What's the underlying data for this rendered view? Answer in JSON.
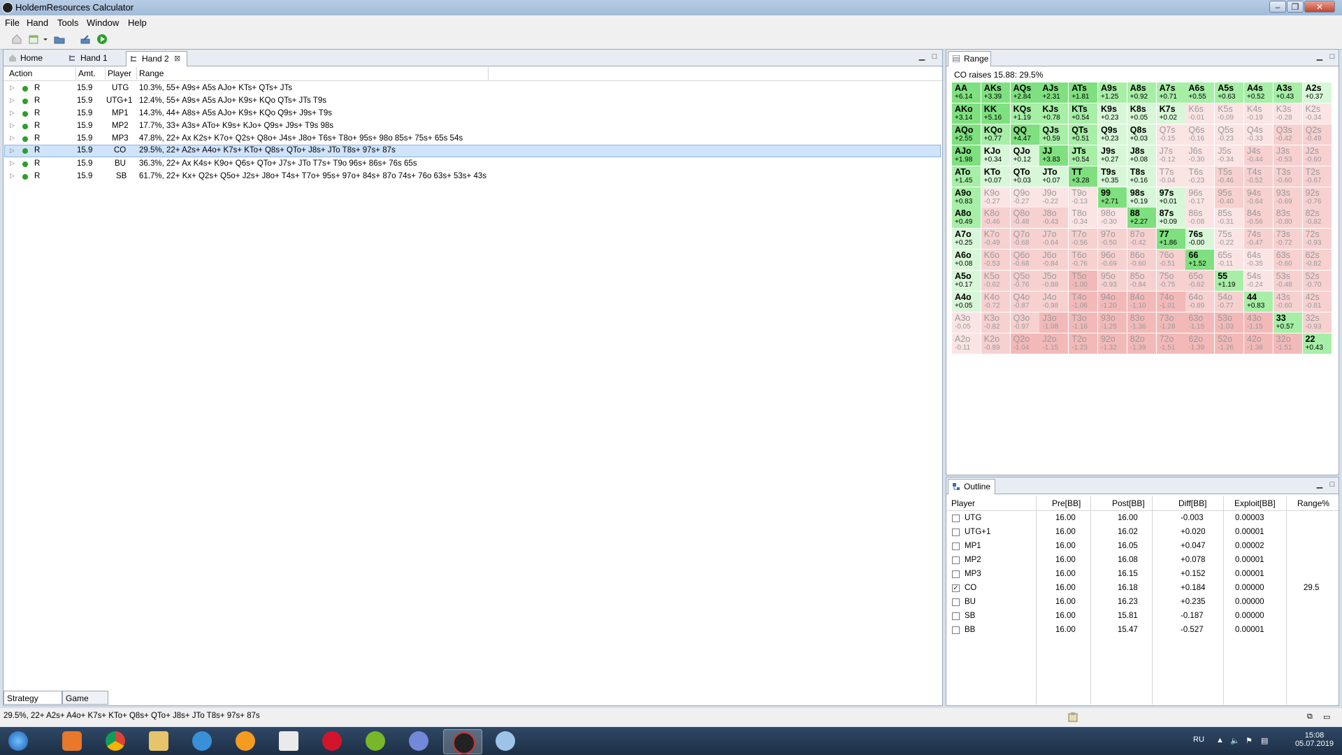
{
  "window": {
    "title": "HoldemResources Calculator"
  },
  "menu": [
    "File",
    "Hand",
    "Tools",
    "Window",
    "Help"
  ],
  "tabs": [
    {
      "label": "Home"
    },
    {
      "label": "Hand 1"
    },
    {
      "label": "Hand 2"
    }
  ],
  "strategy": {
    "headers": {
      "action": "Action",
      "amt": "Amt.",
      "player": "Player",
      "range": "Range"
    },
    "rows": [
      {
        "action": "R",
        "amt": "15.9",
        "player": "UTG",
        "range": "10.3%, 55+ A9s+ A5s AJo+ KTs+ QTs+ JTs"
      },
      {
        "action": "R",
        "amt": "15.9",
        "player": "UTG+1",
        "range": "12.4%, 55+ A9s+ A5s AJo+ K9s+ KQo QTs+ JTs T9s"
      },
      {
        "action": "R",
        "amt": "15.9",
        "player": "MP1",
        "range": "14.3%, 44+ A8s+ A5s AJo+ K9s+ KQo Q9s+ J9s+ T9s"
      },
      {
        "action": "R",
        "amt": "15.9",
        "player": "MP2",
        "range": "17.7%, 33+ A3s+ ATo+ K9s+ KJo+ Q9s+ J9s+ T9s 98s"
      },
      {
        "action": "R",
        "amt": "15.9",
        "player": "MP3",
        "range": "47.8%, 22+ Ax K2s+ K7o+ Q2s+ Q8o+ J4s+ J8o+ T6s+ T8o+ 95s+ 98o 85s+ 75s+ 65s 54s"
      },
      {
        "action": "R",
        "amt": "15.9",
        "player": "CO",
        "range": "29.5%, 22+ A2s+ A4o+ K7s+ KTo+ Q8s+ QTo+ J8s+ JTo T8s+ 97s+ 87s"
      },
      {
        "action": "R",
        "amt": "15.9",
        "player": "BU",
        "range": "36.3%, 22+ Ax K4s+ K9o+ Q6s+ QTo+ J7s+ JTo T7s+ T9o 96s+ 86s+ 76s 65s"
      },
      {
        "action": "R",
        "amt": "15.9",
        "player": "SB",
        "range": "61.7%, 22+ Kx+ Q2s+ Q5o+ J2s+ J8o+ T4s+ T7o+ 95s+ 97o+ 84s+ 87o 74s+ 76o 63s+ 53s+ 43s"
      }
    ],
    "selected_index": 5
  },
  "bottom_tabs": [
    "Strategy Table",
    "Game Tree"
  ],
  "range_panel": {
    "tab": "Range",
    "title": "CO raises 15.88: 29.5%",
    "grid": [
      [
        [
          "AA",
          "+6.14"
        ],
        [
          "AKs",
          "+3.39"
        ],
        [
          "AQs",
          "+2.84"
        ],
        [
          "AJs",
          "+2.31"
        ],
        [
          "ATs",
          "+1.81"
        ],
        [
          "A9s",
          "+1.25"
        ],
        [
          "A8s",
          "+0.92"
        ],
        [
          "A7s",
          "+0.71"
        ],
        [
          "A6s",
          "+0.55"
        ],
        [
          "A5s",
          "+0.63"
        ],
        [
          "A4s",
          "+0.52"
        ],
        [
          "A3s",
          "+0.43"
        ],
        [
          "A2s",
          "+0.37"
        ]
      ],
      [
        [
          "AKo",
          "+3.14"
        ],
        [
          "KK",
          "+5.16"
        ],
        [
          "KQs",
          "+1.19"
        ],
        [
          "KJs",
          "+0.78"
        ],
        [
          "KTs",
          "+0.54"
        ],
        [
          "K9s",
          "+0.23"
        ],
        [
          "K8s",
          "+0.05"
        ],
        [
          "K7s",
          "+0.02"
        ],
        [
          "K6s",
          "-0.01"
        ],
        [
          "K5s",
          "-0.09"
        ],
        [
          "K4s",
          "-0.19"
        ],
        [
          "K3s",
          "-0.28"
        ],
        [
          "K2s",
          "-0.34"
        ]
      ],
      [
        [
          "AQo",
          "+2.55"
        ],
        [
          "KQo",
          "+0.77"
        ],
        [
          "QQ",
          "+4.47"
        ],
        [
          "QJs",
          "+0.59"
        ],
        [
          "QTs",
          "+0.51"
        ],
        [
          "Q9s",
          "+0.23"
        ],
        [
          "Q8s",
          "+0.03"
        ],
        [
          "Q7s",
          "-0.15"
        ],
        [
          "Q6s",
          "-0.16"
        ],
        [
          "Q5s",
          "-0.23"
        ],
        [
          "Q4s",
          "-0.33"
        ],
        [
          "Q3s",
          "-0.42"
        ],
        [
          "Q2s",
          "-0.49"
        ]
      ],
      [
        [
          "AJo",
          "+1.98"
        ],
        [
          "KJo",
          "+0.34"
        ],
        [
          "QJo",
          "+0.12"
        ],
        [
          "JJ",
          "+3.83"
        ],
        [
          "JTs",
          "+0.54"
        ],
        [
          "J9s",
          "+0.27"
        ],
        [
          "J8s",
          "+0.08"
        ],
        [
          "J7s",
          "-0.12"
        ],
        [
          "J6s",
          "-0.30"
        ],
        [
          "J5s",
          "-0.34"
        ],
        [
          "J4s",
          "-0.44"
        ],
        [
          "J3s",
          "-0.53"
        ],
        [
          "J2s",
          "-0.60"
        ]
      ],
      [
        [
          "ATo",
          "+1.45"
        ],
        [
          "KTo",
          "+0.07"
        ],
        [
          "QTo",
          "+0.03"
        ],
        [
          "JTo",
          "+0.07"
        ],
        [
          "TT",
          "+3.28"
        ],
        [
          "T9s",
          "+0.35"
        ],
        [
          "T8s",
          "+0.16"
        ],
        [
          "T7s",
          "-0.04"
        ],
        [
          "T6s",
          "-0.23"
        ],
        [
          "T5s",
          "-0.46"
        ],
        [
          "T4s",
          "-0.52"
        ],
        [
          "T3s",
          "-0.60"
        ],
        [
          "T2s",
          "-0.67"
        ]
      ],
      [
        [
          "A9o",
          "+0.83"
        ],
        [
          "K9o",
          "-0.27"
        ],
        [
          "Q9o",
          "-0.27"
        ],
        [
          "J9o",
          "-0.22"
        ],
        [
          "T9o",
          "-0.13"
        ],
        [
          "99",
          "+2.71"
        ],
        [
          "98s",
          "+0.19"
        ],
        [
          "97s",
          "+0.01"
        ],
        [
          "96s",
          "-0.17"
        ],
        [
          "95s",
          "-0.40"
        ],
        [
          "94s",
          "-0.64"
        ],
        [
          "93s",
          "-0.69"
        ],
        [
          "92s",
          "-0.76"
        ]
      ],
      [
        [
          "A8o",
          "+0.49"
        ],
        [
          "K8o",
          "-0.46"
        ],
        [
          "Q8o",
          "-0.48"
        ],
        [
          "J8o",
          "-0.43"
        ],
        [
          "T8o",
          "-0.34"
        ],
        [
          "98o",
          "-0.30"
        ],
        [
          "88",
          "+2.27"
        ],
        [
          "87s",
          "+0.09"
        ],
        [
          "86s",
          "-0.08"
        ],
        [
          "85s",
          "-0.31"
        ],
        [
          "84s",
          "-0.56"
        ],
        [
          "83s",
          "-0.80"
        ],
        [
          "82s",
          "-0.82"
        ]
      ],
      [
        [
          "A7o",
          "+0.25"
        ],
        [
          "K7o",
          "-0.49"
        ],
        [
          "Q7o",
          "-0.68"
        ],
        [
          "J7o",
          "-0.64"
        ],
        [
          "T7o",
          "-0.56"
        ],
        [
          "97o",
          "-0.50"
        ],
        [
          "87o",
          "-0.42"
        ],
        [
          "77",
          "+1.86"
        ],
        [
          "76s",
          "-0.00"
        ],
        [
          "75s",
          "-0.22"
        ],
        [
          "74s",
          "-0.47"
        ],
        [
          "73s",
          "-0.72"
        ],
        [
          "72s",
          "-0.93"
        ]
      ],
      [
        [
          "A6o",
          "+0.08"
        ],
        [
          "K6o",
          "-0.53"
        ],
        [
          "Q6o",
          "-0.68"
        ],
        [
          "J6o",
          "-0.84"
        ],
        [
          "T6o",
          "-0.76"
        ],
        [
          "96o",
          "-0.69"
        ],
        [
          "86o",
          "-0.60"
        ],
        [
          "76o",
          "-0.51"
        ],
        [
          "66",
          "+1.52"
        ],
        [
          "65s",
          "-0.11"
        ],
        [
          "64s",
          "-0.35"
        ],
        [
          "63s",
          "-0.60"
        ],
        [
          "62s",
          "-0.82"
        ]
      ],
      [
        [
          "A5o",
          "+0.17"
        ],
        [
          "K5o",
          "-0.62"
        ],
        [
          "Q5o",
          "-0.76"
        ],
        [
          "J5o",
          "-0.88"
        ],
        [
          "T5o",
          "-1.00"
        ],
        [
          "95o",
          "-0.93"
        ],
        [
          "85o",
          "-0.84"
        ],
        [
          "75o",
          "-0.75"
        ],
        [
          "65o",
          "-0.62"
        ],
        [
          "55",
          "+1.19"
        ],
        [
          "54s",
          "-0.24"
        ],
        [
          "53s",
          "-0.48"
        ],
        [
          "52s",
          "-0.70"
        ]
      ],
      [
        [
          "A4o",
          "+0.05"
        ],
        [
          "K4o",
          "-0.72"
        ],
        [
          "Q4o",
          "-0.87"
        ],
        [
          "J4o",
          "-0.98"
        ],
        [
          "T4o",
          "-1.06"
        ],
        [
          "94o",
          "-1.20"
        ],
        [
          "84o",
          "-1.10"
        ],
        [
          "74o",
          "-1.01"
        ],
        [
          "64o",
          "-0.89"
        ],
        [
          "54o",
          "-0.77"
        ],
        [
          "44",
          "+0.83"
        ],
        [
          "43s",
          "-0.60"
        ],
        [
          "42s",
          "-0.81"
        ]
      ],
      [
        [
          "A3o",
          "-0.05"
        ],
        [
          "K3o",
          "-0.82"
        ],
        [
          "Q3o",
          "-0.97"
        ],
        [
          "J3o",
          "-1.08"
        ],
        [
          "T3o",
          "-1.16"
        ],
        [
          "93o",
          "-1.25"
        ],
        [
          "83o",
          "-1.36"
        ],
        [
          "73o",
          "-1.28"
        ],
        [
          "63o",
          "-1.15"
        ],
        [
          "53o",
          "-1.03"
        ],
        [
          "43o",
          "-1.15"
        ],
        [
          "33",
          "+0.57"
        ],
        [
          "32s",
          "-0.93"
        ]
      ],
      [
        [
          "A2o",
          "-0.11"
        ],
        [
          "K2o",
          "-0.89"
        ],
        [
          "Q2o",
          "-1.04"
        ],
        [
          "J2o",
          "-1.15"
        ],
        [
          "T2o",
          "-1.23"
        ],
        [
          "92o",
          "-1.32"
        ],
        [
          "82o",
          "-1.39"
        ],
        [
          "72o",
          "-1.51"
        ],
        [
          "62o",
          "-1.39"
        ],
        [
          "52o",
          "-1.26"
        ],
        [
          "42o",
          "-1.38"
        ],
        [
          "32o",
          "-1.51"
        ],
        [
          "22",
          "+0.43"
        ]
      ]
    ],
    "in_range": [
      "AA",
      "AKs",
      "AQs",
      "AJs",
      "ATs",
      "A9s",
      "A8s",
      "A7s",
      "A6s",
      "A5s",
      "A4s",
      "A3s",
      "A2s",
      "AKo",
      "KK",
      "KQs",
      "KJs",
      "KTs",
      "K9s",
      "K8s",
      "K7s",
      "AQo",
      "KQo",
      "QQ",
      "QJs",
      "QTs",
      "Q9s",
      "Q8s",
      "AJo",
      "KJo",
      "QJo",
      "JJ",
      "JTs",
      "J9s",
      "J8s",
      "ATo",
      "KTo",
      "QTo",
      "JTo",
      "TT",
      "T9s",
      "T8s",
      "A9o",
      "99",
      "98s",
      "97s",
      "A8o",
      "88",
      "87s",
      "A7o",
      "77",
      "76s",
      "A6o",
      "66",
      "A5o",
      "55",
      "A4o",
      "44",
      "33",
      "22"
    ]
  },
  "outline": {
    "tab": "Outline",
    "headers": [
      "Player",
      "Pre[BB]",
      "Post[BB]",
      "Diff[BB]",
      "Exploit[BB]",
      "Range%"
    ],
    "rows": [
      {
        "player": "UTG",
        "pre": "16.00",
        "post": "16.00",
        "diff": "-0.003",
        "exploit": "0.00003",
        "range": "",
        "checked": false
      },
      {
        "player": "UTG+1",
        "pre": "16.00",
        "post": "16.02",
        "diff": "+0.020",
        "exploit": "0.00001",
        "range": "",
        "checked": false
      },
      {
        "player": "MP1",
        "pre": "16.00",
        "post": "16.05",
        "diff": "+0.047",
        "exploit": "0.00002",
        "range": "",
        "checked": false
      },
      {
        "player": "MP2",
        "pre": "16.00",
        "post": "16.08",
        "diff": "+0.078",
        "exploit": "0.00001",
        "range": "",
        "checked": false
      },
      {
        "player": "MP3",
        "pre": "16.00",
        "post": "16.15",
        "diff": "+0.152",
        "exploit": "0.00001",
        "range": "",
        "checked": false
      },
      {
        "player": "CO",
        "pre": "16.00",
        "post": "16.18",
        "diff": "+0.184",
        "exploit": "0.00000",
        "range": "29.5",
        "checked": true
      },
      {
        "player": "BU",
        "pre": "16.00",
        "post": "16.23",
        "diff": "+0.235",
        "exploit": "0.00000",
        "range": "",
        "checked": false
      },
      {
        "player": "SB",
        "pre": "16.00",
        "post": "15.81",
        "diff": "-0.187",
        "exploit": "0.00000",
        "range": "",
        "checked": false
      },
      {
        "player": "BB",
        "pre": "16.00",
        "post": "15.47",
        "diff": "-0.527",
        "exploit": "0.00001",
        "range": "",
        "checked": false
      }
    ]
  },
  "status": {
    "text": "29.5%, 22+ A2s+ A4o+ K7s+ KTo+ Q8s+ QTo+ J8s+ JTo T8s+ 97s+ 87s"
  },
  "taskbar": {
    "lang": "RU",
    "time": "15:08",
    "date": "05.07.2019"
  },
  "colors": {
    "range_strong": "#7fe07f",
    "range_weak": "#d8f7d8",
    "out_light": "#fbe4e4",
    "out_dark": "#f3b9b9",
    "selection": "#cfe3fa"
  }
}
